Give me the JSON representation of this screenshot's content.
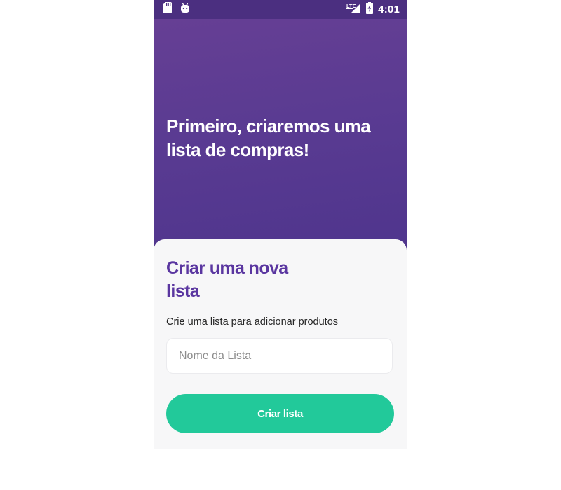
{
  "status_bar": {
    "time": "4:01",
    "network_label": "LTE",
    "left_icons": [
      "sd-card-icon",
      "android-icon"
    ],
    "right_icons": [
      "signal-icon",
      "battery-charging-icon"
    ]
  },
  "hero": {
    "title": "Primeiro, criaremos uma lista de compras!"
  },
  "form_card": {
    "title": "Criar uma nova lista",
    "subtitle": "Crie uma lista para adicionar produtos",
    "list_name_input": {
      "value": "",
      "placeholder": "Nome da Lista"
    },
    "create_button_label": "Criar lista"
  },
  "colors": {
    "status_bar_bg": "#4b2f80",
    "hero_gradient_top": "#663f94",
    "hero_gradient_bottom": "#4f358d",
    "card_bg": "#f7f7f8",
    "card_title": "#5a36a0",
    "primary_button": "#22c99a",
    "text_white": "#ffffff"
  }
}
